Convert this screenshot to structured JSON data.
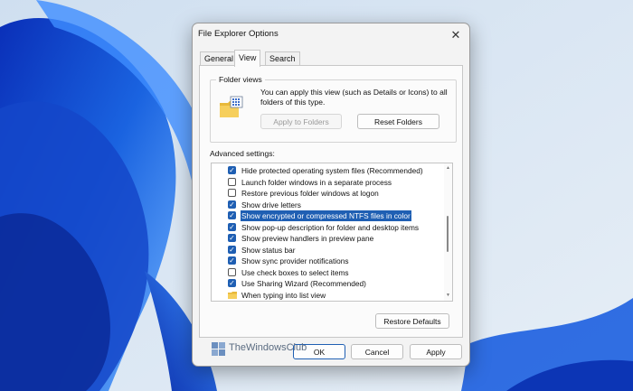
{
  "dialog": {
    "title": "File Explorer Options",
    "close_glyph": "✕",
    "tabs": [
      {
        "label": "General",
        "active": false
      },
      {
        "label": "View",
        "active": true
      },
      {
        "label": "Search",
        "active": false
      }
    ],
    "folder_views": {
      "label": "Folder views",
      "description": "You can apply this view (such as Details or Icons) to all folders of this type.",
      "apply_label": "Apply to Folders",
      "reset_label": "Reset Folders"
    },
    "advanced": {
      "label": "Advanced settings:",
      "items": [
        {
          "label": "Hide protected operating system files (Recommended)",
          "checked": true
        },
        {
          "label": "Launch folder windows in a separate process",
          "checked": false
        },
        {
          "label": "Restore previous folder windows at logon",
          "checked": false
        },
        {
          "label": "Show drive letters",
          "checked": true
        },
        {
          "label": "Show encrypted or compressed NTFS files in color",
          "checked": true,
          "selected": true
        },
        {
          "label": "Show pop-up description for folder and desktop items",
          "checked": true
        },
        {
          "label": "Show preview handlers in preview pane",
          "checked": true
        },
        {
          "label": "Show status bar",
          "checked": true
        },
        {
          "label": "Show sync provider notifications",
          "checked": true
        },
        {
          "label": "Use check boxes to select items",
          "checked": false
        },
        {
          "label": "Use Sharing Wizard (Recommended)",
          "checked": true
        },
        {
          "label": "When typing into list view",
          "type": "folder"
        }
      ]
    },
    "restore_defaults_label": "Restore Defaults",
    "ok_label": "OK",
    "cancel_label": "Cancel",
    "apply_label": "Apply"
  },
  "watermark": {
    "text": "TheWindowsClub"
  },
  "colors": {
    "accent": "#1f5fb3",
    "desktop_bg": "#d7e4f0",
    "bloom": "#1b5fd6"
  }
}
